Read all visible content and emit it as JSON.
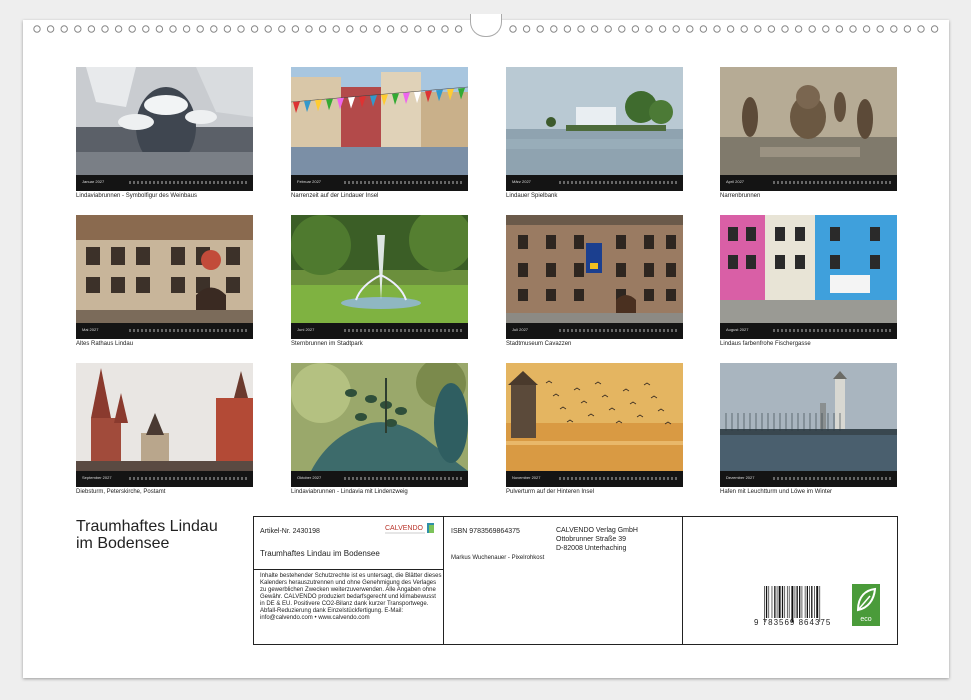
{
  "months": [
    {
      "month": "Januar 2027",
      "caption": "Lindaviabrunnen - Symbolfigur des Weinbaus",
      "scene": "winter-fountain"
    },
    {
      "month": "Februar 2027",
      "caption": "Narrenzeit auf der Lindauer Insel",
      "scene": "flags-street"
    },
    {
      "month": "März 2027",
      "caption": "Lindauer Spielbank",
      "scene": "lake-casino"
    },
    {
      "month": "April 2027",
      "caption": "Narrenbrunnen",
      "scene": "bronze-fountain"
    },
    {
      "month": "Mai 2027",
      "caption": "Altes Rathaus Lindau",
      "scene": "town-hall"
    },
    {
      "month": "Juni 2027",
      "caption": "Sternbrunnen im Stadtpark",
      "scene": "park-fountain"
    },
    {
      "month": "Juli 2027",
      "caption": "Stadtmuseum Cavazzen",
      "scene": "museum"
    },
    {
      "month": "August 2027",
      "caption": "Lindaus farbenfrohe Fischergasse",
      "scene": "colorful-houses"
    },
    {
      "month": "September 2027",
      "caption": "Diebsturm, Peterskirche, Postamt",
      "scene": "towers"
    },
    {
      "month": "Oktober 2027",
      "caption": "Lindaviabrunnen - Lindavia mit Lindenzweig",
      "scene": "bronze-detail"
    },
    {
      "month": "November 2027",
      "caption": "Pulverturm auf der Hinteren Insel",
      "scene": "sunset-tower"
    },
    {
      "month": "Dezember 2027",
      "caption": "Hafen mit Leuchtturm und Löwe im Winter",
      "scene": "harbor"
    }
  ],
  "title_line1": "Traumhaftes Lindau",
  "title_line2": "im Bodensee",
  "info": {
    "article": "Artikel-Nr. 2430198",
    "brand": "CALVENDO",
    "product_title": "Traumhaftes Lindau im Bodensee",
    "isbn": "ISBN 9783569864375",
    "author": "Markus Wuchenauer - Pixelrohkost",
    "publisher_line1": "CALVENDO Verlag GmbH",
    "publisher_line2": "Ottobrunner Straße 39",
    "publisher_line3": "D-82008 Unterhaching",
    "legal": "Inhalte bestehender Schutzrechte ist es untersagt, die Blätter dieses Kalenders herauszutrennen und ohne Genehmigung des Verlages zu gewerblichen Zwecken weiterzuverwenden. Alle Angaben ohne Gewähr. CALVENDO produziert bedarfsgerecht und klimabewusst in DE & EU. Positivere CO2-Bilanz dank kurzer Transportwege. Abfall-Reduzierung dank Einzelstückfertigung. E-Mail: info@calvendo.com • www.calvendo.com",
    "barcode_number": "9 783569 864375",
    "eco_label": "eco"
  }
}
